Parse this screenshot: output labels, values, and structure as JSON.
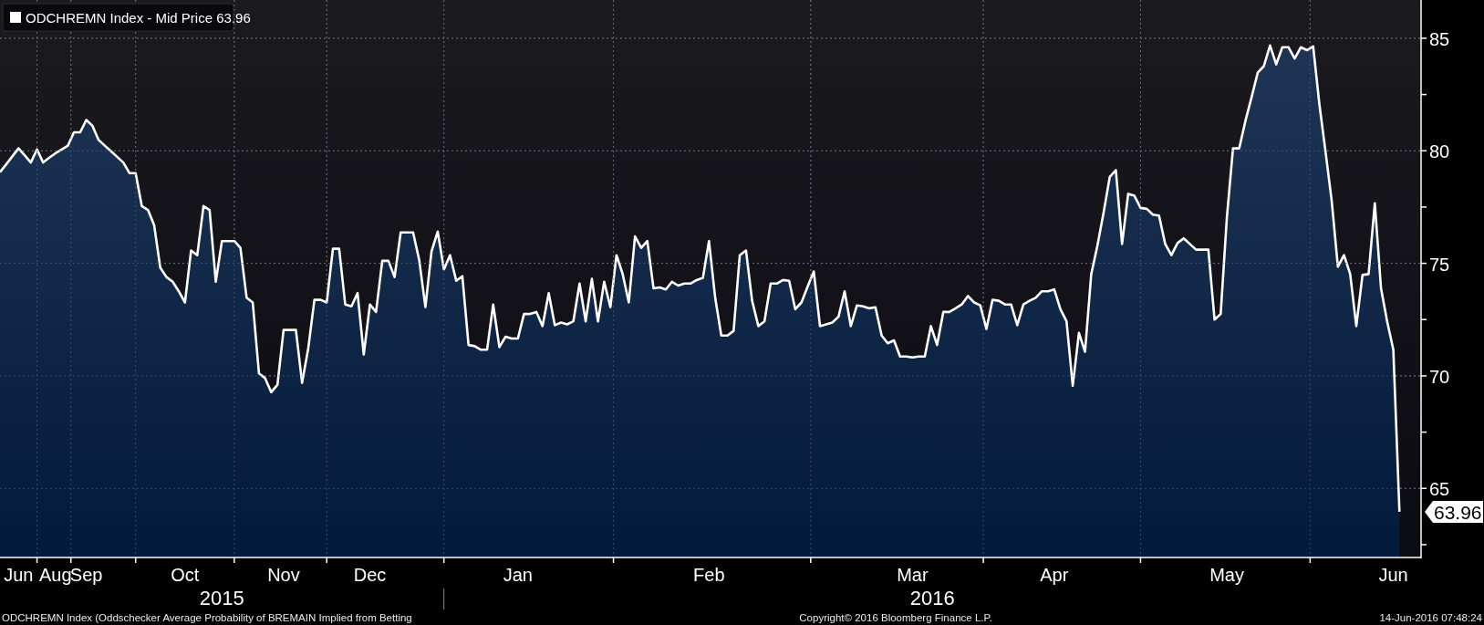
{
  "chart": {
    "chart_data": {
      "type": "area",
      "grid": true,
      "ylim": [
        61.93,
        86.7
      ],
      "yticks": [
        65,
        70,
        75,
        80,
        85
      ],
      "categories": [
        null,
        null,
        null,
        "Jun",
        null,
        null,
        null,
        null,
        null,
        "Aug",
        null,
        null,
        null,
        null,
        "Sep",
        null,
        null,
        null,
        null,
        null,
        null,
        null,
        null,
        null,
        null,
        null,
        null,
        null,
        null,
        null,
        "Oct",
        null,
        null,
        null,
        null,
        null,
        null,
        null,
        null,
        null,
        null,
        null,
        null,
        null,
        null,
        null,
        "Nov",
        null,
        null,
        null,
        null,
        null,
        null,
        null,
        null,
        null,
        null,
        null,
        null,
        null,
        "Dec",
        null,
        null,
        null,
        null,
        null,
        null,
        null,
        null,
        null,
        null,
        null,
        null,
        null,
        null,
        null,
        null,
        null,
        null,
        null,
        null,
        null,
        null,
        null,
        "Jan",
        null,
        null,
        null,
        null,
        null,
        null,
        null,
        null,
        null,
        null,
        null,
        null,
        null,
        null,
        null,
        null,
        null,
        null,
        null,
        null,
        null,
        null,
        null,
        null,
        null,
        null,
        null,
        null,
        null,
        null,
        "Feb",
        null,
        null,
        null,
        null,
        null,
        null,
        null,
        null,
        null,
        null,
        null,
        null,
        null,
        null,
        null,
        null,
        null,
        null,
        null,
        null,
        null,
        null,
        null,
        null,
        null,
        null,
        null,
        null,
        null,
        null,
        null,
        null,
        "Mar",
        null,
        null,
        null,
        null,
        null,
        null,
        null,
        null,
        null,
        null,
        null,
        null,
        null,
        null,
        null,
        null,
        null,
        null,
        null,
        null,
        null,
        null,
        "Apr",
        null,
        null,
        null,
        null,
        null,
        null,
        null,
        null,
        null,
        null,
        null,
        null,
        null,
        null,
        null,
        null,
        null,
        null,
        null,
        null,
        null,
        null,
        null,
        null,
        null,
        null,
        null,
        "May",
        null,
        null,
        null,
        null,
        null,
        null,
        null,
        null,
        null,
        null,
        null,
        null,
        null,
        null,
        null,
        null,
        null,
        null,
        null,
        null,
        null,
        null,
        null,
        null,
        null,
        null,
        "Jun",
        null
      ],
      "series": [
        {
          "name": "ODCHREMN Index - Mid Price 63.96",
          "color": "#ffffff",
          "values": [
            79.05,
            79.4,
            79.75,
            80.11,
            79.8,
            79.48,
            80.06,
            79.48,
            79.7,
            79.89,
            80.06,
            80.23,
            80.82,
            80.82,
            81.37,
            81.11,
            80.48,
            80.23,
            79.98,
            79.73,
            79.48,
            79.01,
            79.01,
            77.54,
            77.37,
            76.7,
            74.81,
            74.39,
            74.18,
            73.76,
            73.26,
            75.57,
            75.36,
            77.54,
            77.37,
            74.18,
            75.99,
            75.99,
            75.99,
            75.69,
            73.47,
            73.26,
            70.11,
            69.9,
            69.27,
            69.61,
            72.04,
            72.04,
            72.04,
            69.69,
            71.24,
            73.38,
            73.38,
            73.26,
            75.65,
            75.65,
            73.17,
            73.09,
            73.68,
            70.95,
            73.17,
            72.84,
            75.11,
            75.11,
            74.39,
            76.37,
            76.37,
            76.37,
            75.15,
            73.05,
            75.53,
            76.41,
            74.73,
            75.36,
            74.22,
            74.43,
            71.37,
            71.32,
            71.16,
            71.16,
            73.17,
            71.28,
            71.74,
            71.66,
            71.66,
            72.75,
            72.75,
            72.84,
            72.21,
            73.68,
            72.25,
            72.37,
            72.29,
            72.42,
            74.1,
            72.42,
            74.31,
            72.42,
            74.18,
            73.05,
            75.36,
            74.52,
            73.26,
            76.2,
            75.69,
            75.99,
            73.89,
            73.93,
            73.84,
            74.18,
            74.01,
            74.1,
            74.1,
            74.26,
            74.35,
            75.99,
            73.47,
            71.79,
            71.79,
            72.0,
            75.36,
            75.57,
            73.34,
            72.21,
            72.42,
            74.1,
            74.1,
            74.26,
            74.22,
            72.96,
            73.26,
            73.97,
            74.64,
            72.21,
            72.29,
            72.37,
            72.63,
            73.76,
            72.21,
            73.13,
            73.09,
            73.0,
            73.05,
            71.79,
            71.45,
            71.58,
            70.86,
            70.86,
            70.82,
            70.86,
            70.86,
            72.21,
            71.37,
            72.84,
            72.84,
            73.0,
            73.17,
            73.55,
            73.26,
            73.13,
            72.08,
            73.38,
            73.34,
            73.17,
            73.17,
            72.25,
            73.17,
            73.34,
            73.47,
            73.76,
            73.76,
            73.84,
            72.96,
            72.42,
            69.56,
            71.91,
            71.07,
            74.52,
            75.78,
            77.24,
            78.84,
            79.14,
            75.86,
            78.09,
            78.0,
            77.46,
            77.42,
            77.16,
            77.12,
            75.86,
            75.36,
            75.9,
            76.11,
            75.86,
            75.61,
            75.61,
            75.61,
            72.5,
            72.75,
            77.04,
            80.11,
            80.11,
            81.32,
            82.37,
            83.47,
            83.76,
            84.68,
            83.84,
            84.6,
            84.6,
            84.1,
            84.6,
            84.47,
            84.64,
            82.08,
            79.98,
            77.79,
            74.85,
            75.36,
            74.52,
            72.21,
            74.48,
            74.52,
            77.67,
            73.89,
            72.42,
            71.16,
            63.96
          ]
        }
      ],
      "annotations": [
        "63.96"
      ]
    },
    "years": [
      {
        "label": "2015"
      },
      {
        "label": "2016"
      }
    ]
  },
  "footer": {
    "description": "ODCHREMN Index (Oddschecker Average Probability of BREMAIN Implied from Betting",
    "copyright": "Copyright© 2016 Bloomberg Finance L.P.",
    "timestamp": "14-Jun-2016 07:48:24"
  }
}
